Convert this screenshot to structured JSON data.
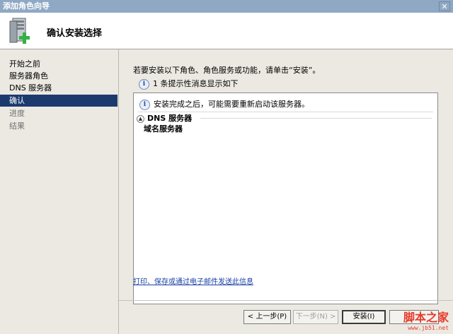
{
  "window": {
    "title": "添加角色向导",
    "close_symbol": "✕"
  },
  "header": {
    "title": "确认安装选择",
    "icon": "server-add-icon"
  },
  "sidebar": {
    "items": [
      {
        "label": "开始之前",
        "state": "normal"
      },
      {
        "label": "服务器角色",
        "state": "normal"
      },
      {
        "label": "DNS 服务器",
        "state": "normal"
      },
      {
        "label": "确认",
        "state": "active"
      },
      {
        "label": "进度",
        "state": "disabled"
      },
      {
        "label": "结果",
        "state": "disabled"
      }
    ]
  },
  "main": {
    "instruction": "若要安装以下角色、角色服务或功能，请单击“安装”。",
    "hint": "1 条提示性消息显示如下",
    "panel": {
      "note": "安装完成之后，可能需要重新启动该服务器。",
      "section_title": "DNS 服务器",
      "section_item": "域名服务器"
    },
    "link": "打印、保存或通过电子邮件发送此信息"
  },
  "buttons": {
    "previous": "< 上一步(P)",
    "next": "下一步(N) >",
    "install": "安装(I)",
    "cancel": ""
  },
  "watermark": {
    "main": "脚本之家",
    "sub": "www.jb51.net"
  },
  "colors": {
    "active_nav": "#1c3a6e",
    "titlebar": "#8fa8c4",
    "link": "#1a3fa6",
    "watermark": "#e63a2a"
  }
}
